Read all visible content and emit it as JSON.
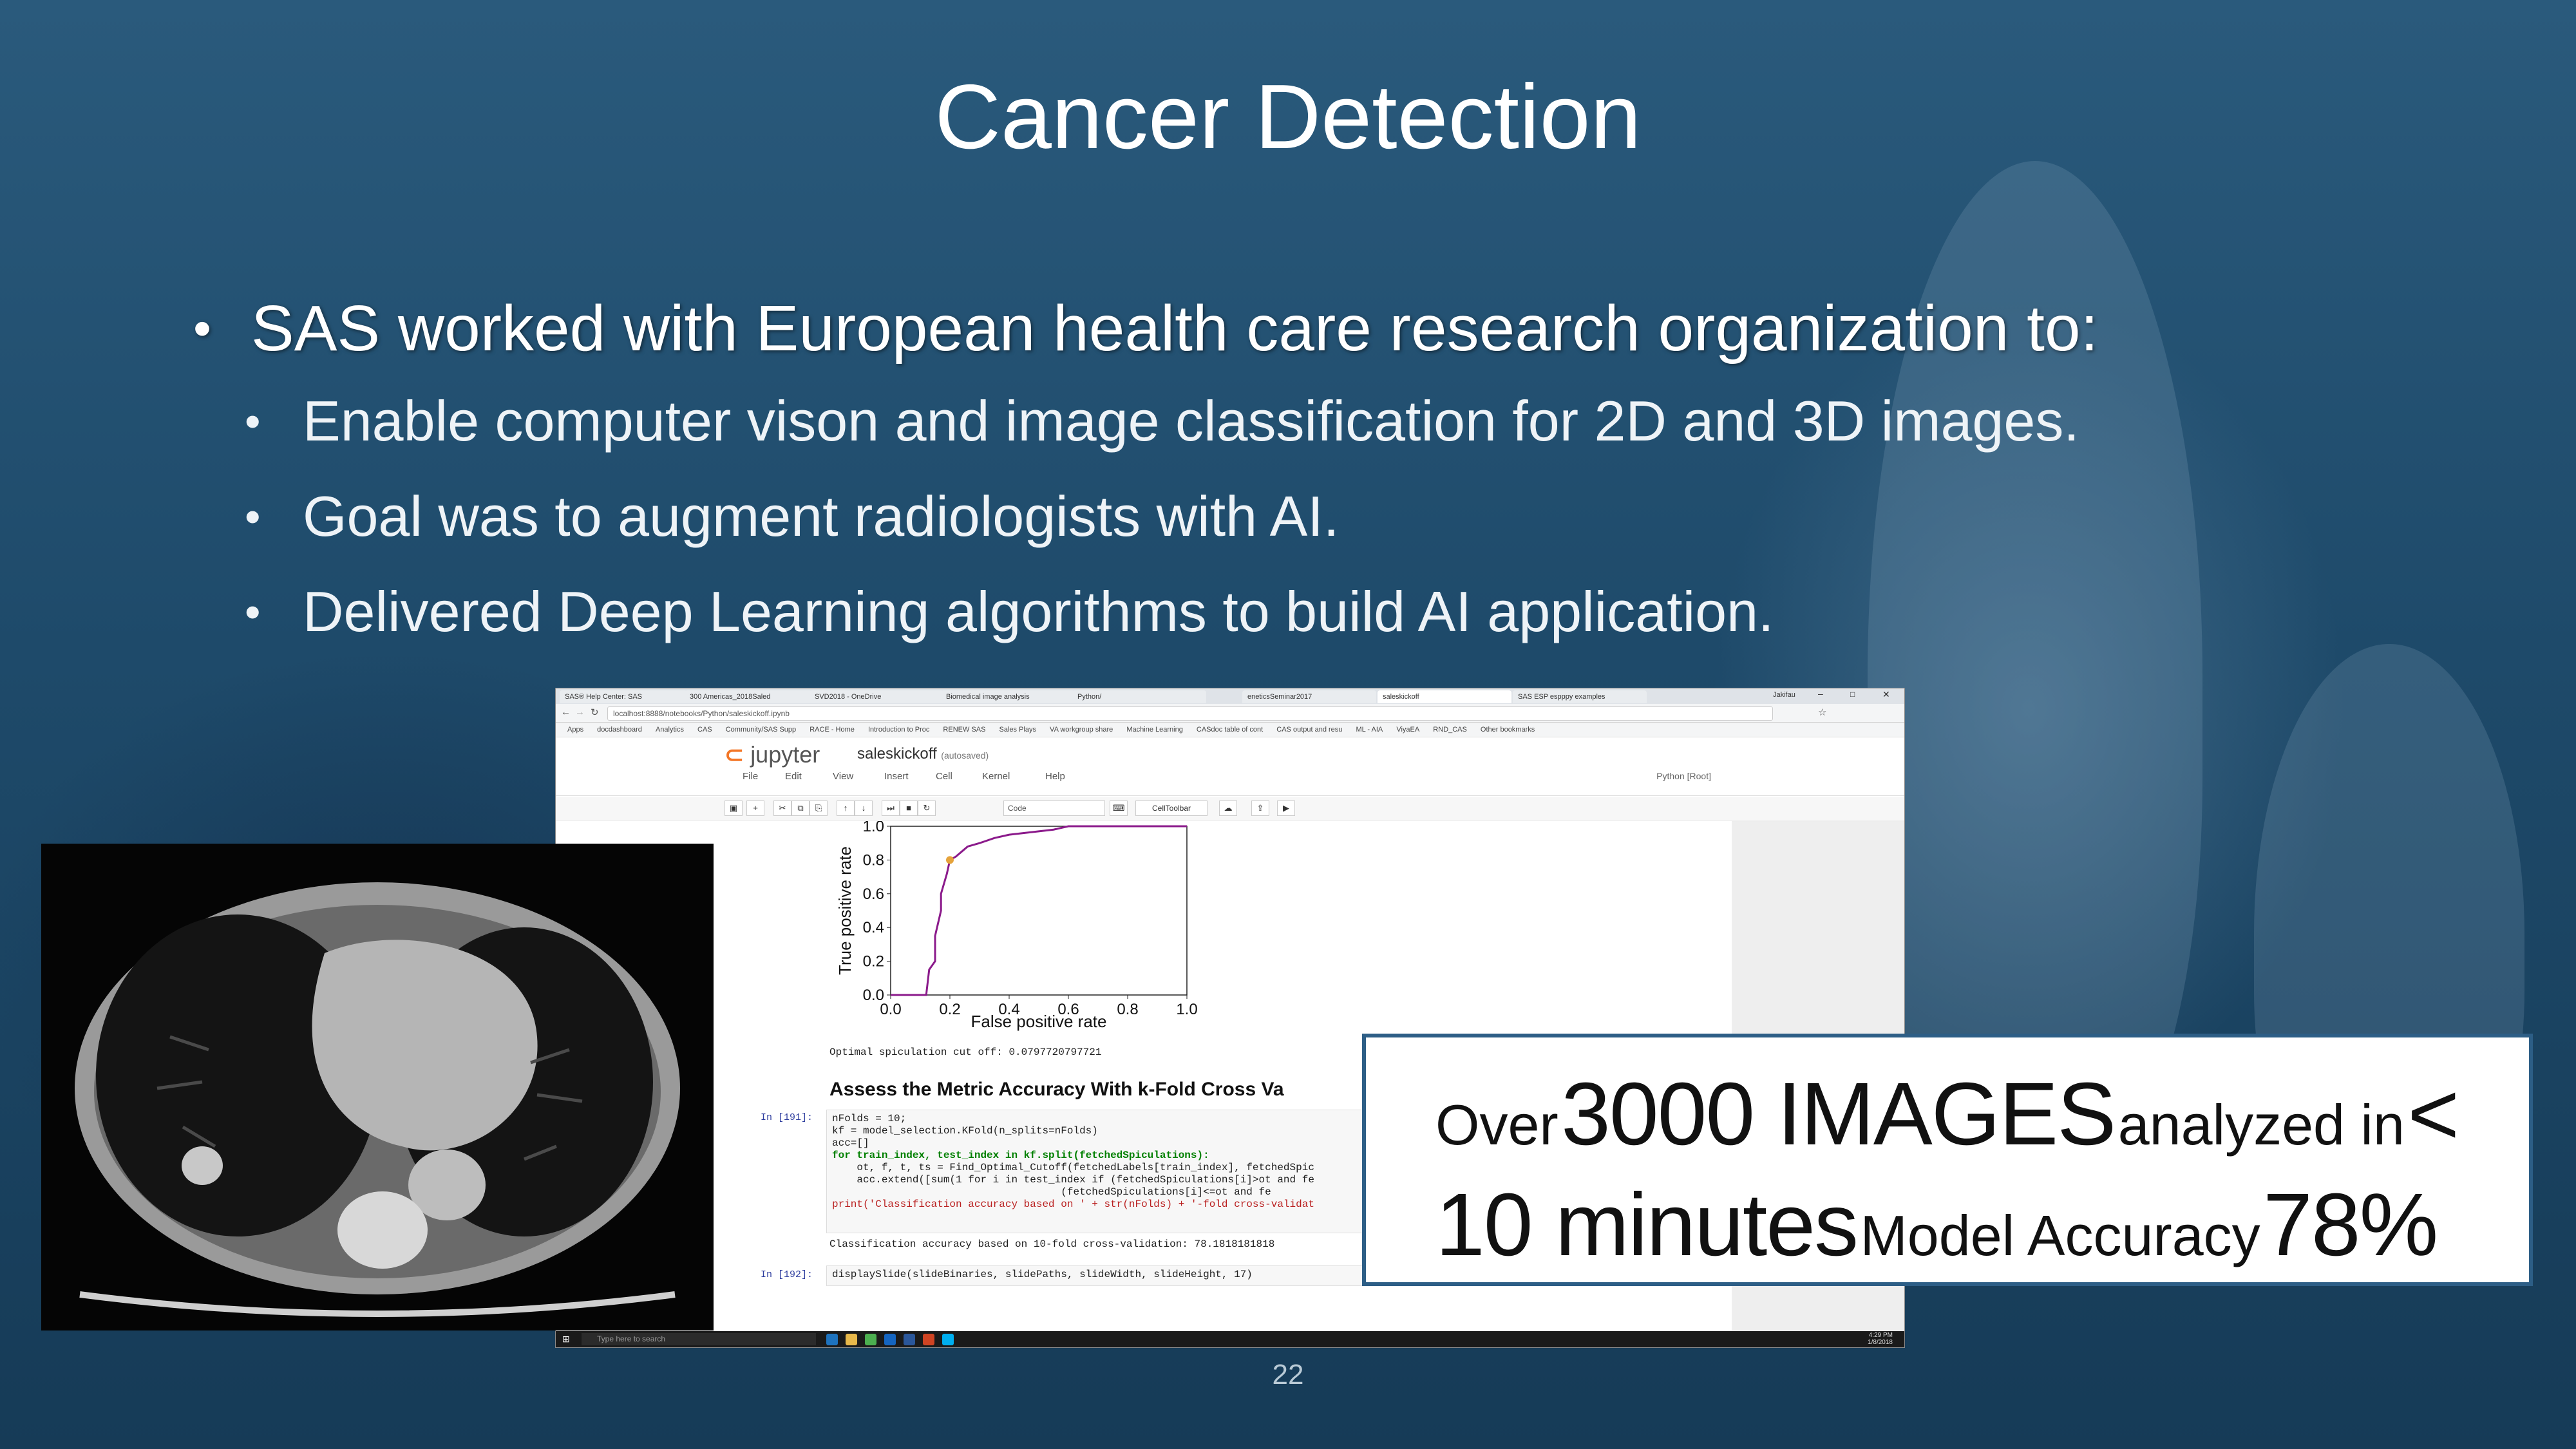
{
  "slide": {
    "title": "Cancer Detection",
    "bullet_main": "SAS worked with European health care research organization to:",
    "sub_bullets": [
      "Enable computer vison and image classification for 2D and 3D images.",
      "Goal was to augment radiologists with AI.",
      "Delivered Deep Learning algorithms to build AI application."
    ],
    "page_number": "22"
  },
  "callout": {
    "over": "Over",
    "images": "3000 IMAGES",
    "analyzed": "analyzed in",
    "lt": "<",
    "minutes": "10 minutes",
    "accuracy_label": "Model Accuracy",
    "accuracy_value": "78%"
  },
  "browser": {
    "tabs": [
      "SAS® Help Center: SAS",
      "300 Americas_2018Saled",
      "SVD2018 - OneDrive",
      "Biomedical image analysis",
      "Python/",
      "eneticsSeminar2017",
      "saleskickoff",
      "SAS ESP espppy examples"
    ],
    "user": "Jakifau",
    "url": "localhost:8888/notebooks/Python/saleskickoff.ipynb",
    "bookmarks": [
      "Apps",
      "docdashboard",
      "Analytics",
      "CAS",
      "Community/SAS Supp",
      "RACE - Home",
      "Introduction to Proc",
      "RENEW SAS",
      "Sales Plays",
      "VA workgroup share",
      "Machine Learning",
      "CASdoc table of cont",
      "CAS output and resu",
      "ML - AIA",
      "ViyaEA",
      "RND_CAS",
      "Other bookmarks"
    ]
  },
  "jupyter": {
    "logo": "jupyter",
    "notebook_name": "saleskickoff",
    "autosaved": "(autosaved)",
    "menus": [
      "File",
      "Edit",
      "View",
      "Insert",
      "Cell",
      "Kernel",
      "Help"
    ],
    "kernel": "Python [Root]",
    "cell_type": "Code",
    "cell_toolbar": "CellToolbar",
    "cutoff_text": "Optimal spiculation cut off: 0.0797720797721",
    "heading": "Assess the Metric Accuracy With k-Fold Cross Va",
    "prompt_191": "In [191]:",
    "code_lines": [
      "nFolds = 10;",
      "kf = model_selection.KFold(n_splits=nFolds)",
      "acc=[]",
      "for train_index, test_index in kf.split(fetchedSpiculations):",
      "    ot, f, t, ts = Find_Optimal_Cutoff(fetchedLabels[train_index], fetchedSpic",
      "    acc.extend([sum(1 for i in test_index if (fetchedSpiculations[i]>ot and fe",
      "                                     (fetchedSpiculations[i]<=ot and fe",
      "print('Classification accuracy based on ' + str(nFolds) + '-fold cross-validat"
    ],
    "output_text": "Classification accuracy based on 10-fold cross-validation: 78.1818181818",
    "prompt_192": "In [192]:",
    "code_192": "displaySlide(slideBinaries, slidePaths, slideWidth, slideHeight, 17)"
  },
  "taskbar": {
    "search_placeholder": "Type here to search",
    "time": "4:29 PM",
    "date": "1/8/2018"
  },
  "chart_data": {
    "type": "line",
    "xlabel": "False positive rate",
    "ylabel": "True positive rate",
    "xlim": [
      0,
      1
    ],
    "ylim": [
      0,
      1
    ],
    "xticks": [
      "0.0",
      "0.2",
      "0.4",
      "0.6",
      "0.8",
      "1.0"
    ],
    "yticks": [
      "0.0",
      "0.2",
      "0.4",
      "0.6",
      "0.8",
      "1.0"
    ],
    "series": [
      {
        "color": "#8b1a8b",
        "x": [
          0.0,
          0.12,
          0.13,
          0.15,
          0.15,
          0.17,
          0.17,
          0.19,
          0.2,
          0.22,
          0.24,
          0.26,
          0.3,
          0.35,
          0.4,
          0.5,
          0.55,
          0.6,
          0.8,
          1.0
        ],
        "y": [
          0.0,
          0.0,
          0.15,
          0.2,
          0.35,
          0.5,
          0.6,
          0.72,
          0.8,
          0.82,
          0.85,
          0.88,
          0.9,
          0.93,
          0.95,
          0.97,
          0.98,
          1.0,
          1.0,
          1.0
        ]
      }
    ],
    "marker": {
      "x": 0.2,
      "y": 0.8,
      "color": "#e5a33b"
    }
  },
  "colors": {
    "callout_border": "#2d5e86",
    "slide_bg": "#1d4d6e"
  }
}
